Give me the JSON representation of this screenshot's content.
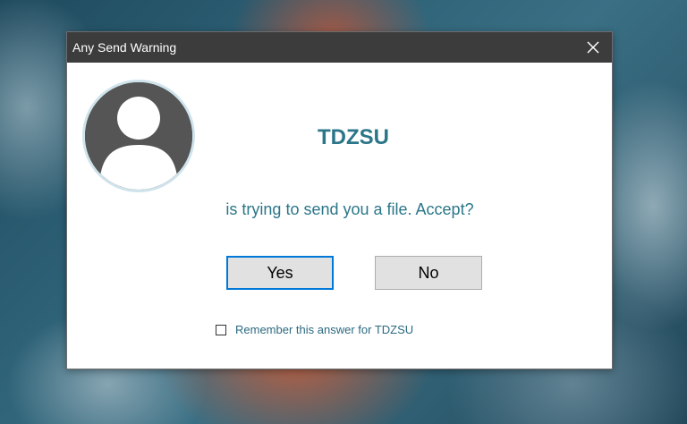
{
  "window": {
    "title": "Any Send Warning",
    "close_icon": "close-icon"
  },
  "content": {
    "avatar_icon": "user-avatar-icon",
    "sender_name": "TDZSU",
    "message": "is trying to send you a file. Accept?"
  },
  "buttons": {
    "yes_label": "Yes",
    "no_label": "No"
  },
  "remember": {
    "checked": false,
    "label": "Remember this answer for TDZSU"
  },
  "colors": {
    "accent_text": "#2b7688",
    "titlebar": "#3c3c3c",
    "focus_border": "#0078d7"
  }
}
